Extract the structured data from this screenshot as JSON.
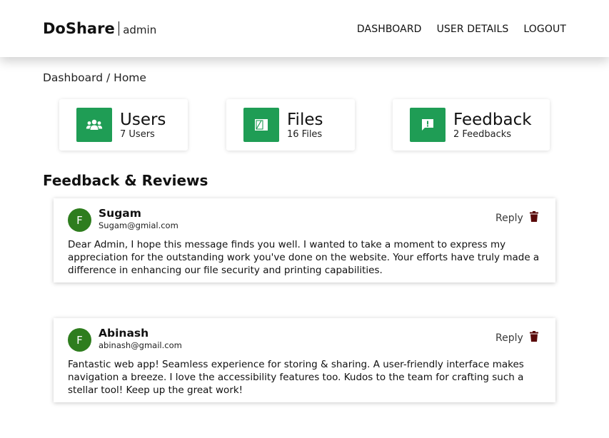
{
  "header": {
    "brand": "DoShare",
    "role": "admin",
    "nav": [
      "DASHBOARD",
      "USER DETAILS",
      "LOGOUT"
    ]
  },
  "breadcrumb": "Dashboard / Home",
  "stats": [
    {
      "title": "Users",
      "sub": "7 Users",
      "icon": "users-icon"
    },
    {
      "title": "Files",
      "sub": "16 Files",
      "icon": "files-icon"
    },
    {
      "title": "Feedback",
      "sub": "2 Feedbacks",
      "icon": "feedback-icon"
    }
  ],
  "section_title": "Feedback & Reviews",
  "reviews": [
    {
      "initial": "F",
      "name": "Sugam",
      "email": "Sugam@gmial.com",
      "reply": "Reply",
      "message": "Dear Admin, I hope this message finds you well. I wanted to take a moment to express my appreciation for the outstanding work you've done on the website. Your efforts have truly made a difference in enhancing our file security and printing capabilities."
    },
    {
      "initial": "F",
      "name": "Abinash",
      "email": "abinash@gmail.com",
      "reply": "Reply",
      "message": "Fantastic web app! Seamless experience for storing & sharing. A user-friendly interface makes navigation a breeze. I love the accessibility features too. Kudos to the team for crafting such a stellar tool! Keep up the great work!"
    }
  ],
  "colors": {
    "accent": "#1f9d55",
    "avatar": "#2e7d1e",
    "trash": "#5a0a0a"
  }
}
